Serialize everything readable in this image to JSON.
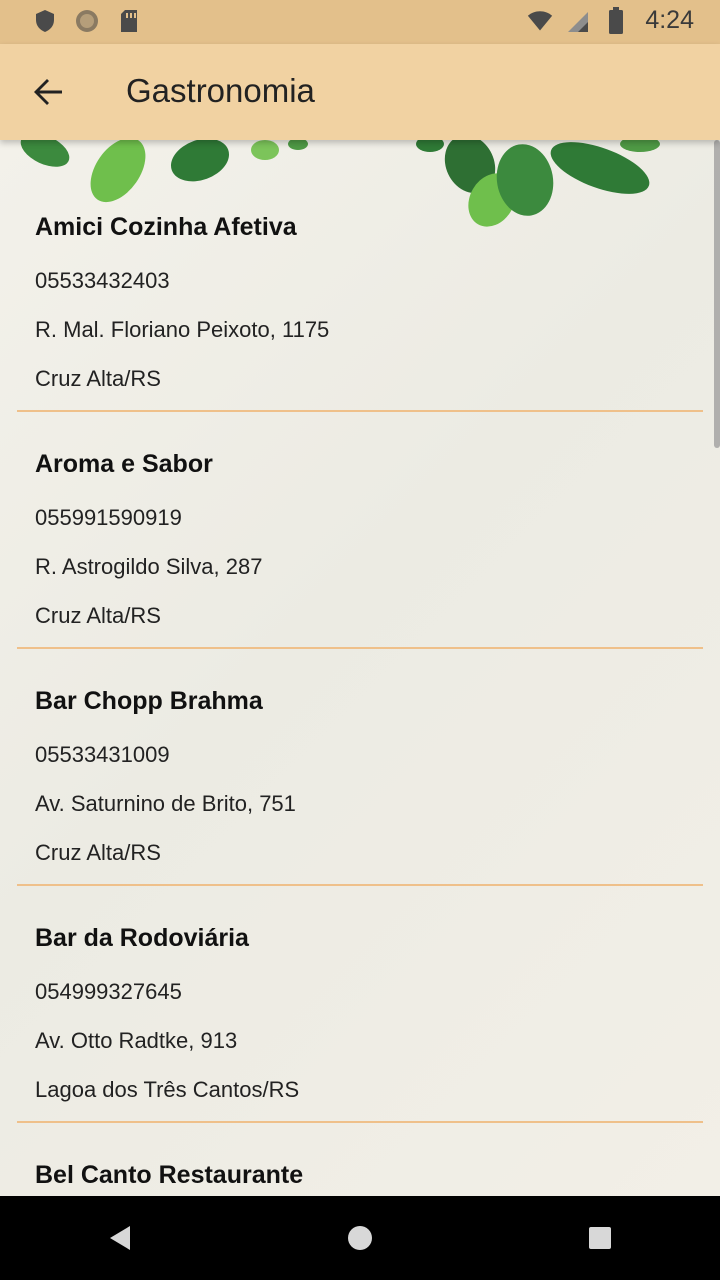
{
  "status_bar": {
    "time": "4:24",
    "left_icons": [
      "shield-icon",
      "settings-round-icon",
      "sd-card-icon"
    ],
    "right_icons": [
      "wifi-icon",
      "cell-signal-icon",
      "battery-icon"
    ]
  },
  "app_bar": {
    "title": "Gastronomia",
    "back_icon": "arrow-back-icon",
    "background": "#f1d2a2"
  },
  "list": [
    {
      "name": "Amici Cozinha Afetiva",
      "phone": "05533432403",
      "street": "R. Mal. Floriano Peixoto, 1175",
      "city": "Cruz Alta/RS"
    },
    {
      "name": "Aroma e Sabor",
      "phone": "055991590919",
      "street": "R. Astrogildo Silva, 287",
      "city": "Cruz Alta/RS"
    },
    {
      "name": "Bar Chopp Brahma",
      "phone": "05533431009",
      "street": "Av. Saturnino de Brito, 751",
      "city": "Cruz Alta/RS"
    },
    {
      "name": "Bar da Rodoviária",
      "phone": "054999327645",
      "street": "Av. Otto Radtke, 913",
      "city": "Lagoa dos Três Cantos/RS"
    },
    {
      "name": "Bel Canto Restaurante",
      "phone": "",
      "street": "",
      "city": ""
    }
  ],
  "colors": {
    "divider": "#efc08a",
    "status_bar": "#e3c08b"
  },
  "nav_bar": {
    "icons": [
      "back-triangle-icon",
      "home-circle-icon",
      "recents-square-icon"
    ]
  }
}
